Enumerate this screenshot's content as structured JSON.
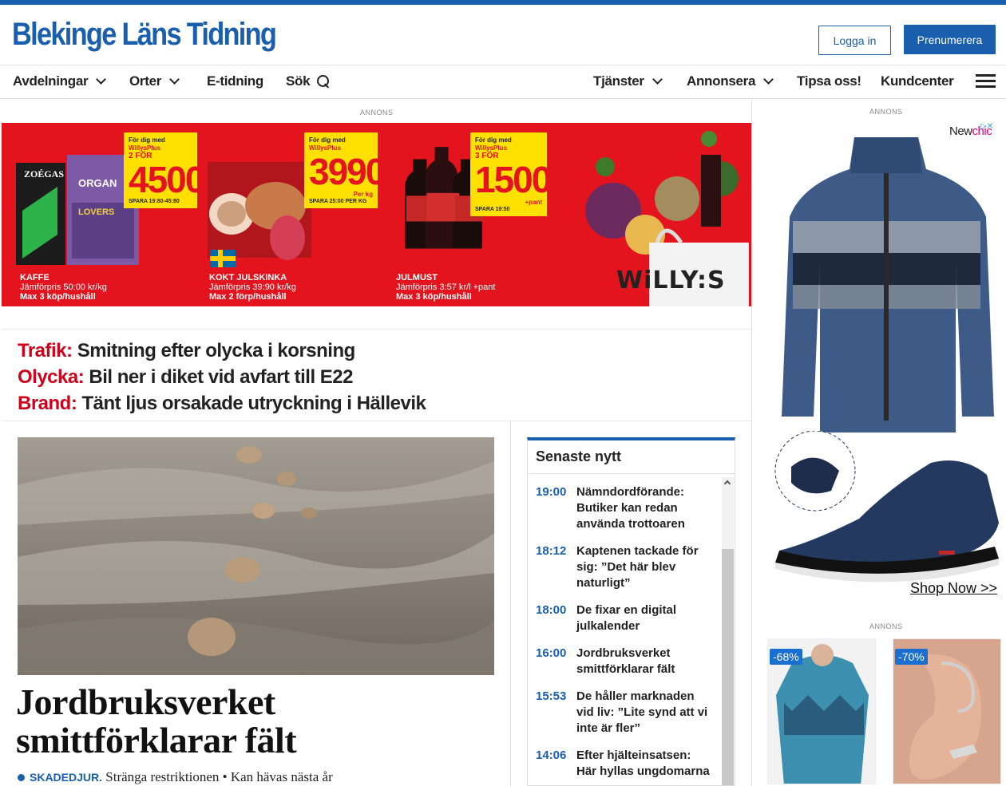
{
  "site": {
    "logo": "Blekinge Läns Tidning",
    "login_label": "Logga in",
    "subscribe_label": "Prenumerera"
  },
  "nav": {
    "left": [
      {
        "label": "Avdelningar",
        "dropdown": true
      },
      {
        "label": "Orter",
        "dropdown": true
      },
      {
        "label": "E-tidning",
        "dropdown": false
      },
      {
        "label": "Sök",
        "icon": "search-icon"
      }
    ],
    "right": [
      {
        "label": "Tjänster",
        "dropdown": true
      },
      {
        "label": "Annonsera",
        "dropdown": true
      },
      {
        "label": "Tipsa oss!",
        "dropdown": false
      },
      {
        "label": "Kundcenter",
        "dropdown": false
      }
    ],
    "menu_icon": "hamburger-icon"
  },
  "ads": {
    "label": "ANNONS",
    "willys": {
      "brand": "WiLLY:S",
      "offers": [
        {
          "tag": "För dig med",
          "program": "WillysPlus",
          "qty": "2 FÖR",
          "price": "4500",
          "save": "SPARA 19:80-45:80",
          "name": "KAFFE",
          "compare": "Jämförpris 50:00 kr/kg",
          "limit": "Max 3 köp/hushåll",
          "product_text": "ZOÉGAS"
        },
        {
          "tag": "För dig med",
          "program": "WillysPlus",
          "qty": "",
          "price": "3990",
          "unit": "Per kg",
          "save": "SPARA 25:00 PER KG",
          "name": "KOKT JULSKINKA",
          "compare": "Jämförpris 39:90 kr/kg",
          "limit": "Max 2 förp/hushåll"
        },
        {
          "tag": "För dig med",
          "program": "WillysPlus",
          "qty": "3 FÖR",
          "price": "1500",
          "unit": "+pant",
          "save": "SPARA 19:50",
          "name": "JULMUST",
          "compare": "Jämförpris 3:57 kr/l +pant",
          "limit": "Max 3 köp/hushåll"
        }
      ]
    },
    "newchic": {
      "brand_a": "New",
      "brand_b": "chic",
      "cta": "Shop Now >>"
    },
    "products": [
      {
        "discount": "-68%"
      },
      {
        "discount": "-70%"
      }
    ]
  },
  "headlines": [
    {
      "kicker": "Trafik:",
      "text": " Smitning efter olycka i korsning"
    },
    {
      "kicker": "Olycka:",
      "text": " Bil ner i diket vid avfart till E22"
    },
    {
      "kicker": "Brand:",
      "text": " Tänt ljus orsakade utryckning i Hällevik"
    }
  ],
  "article": {
    "title_line1": "Jordbruksverket",
    "title_line2": "smittförklarar fält",
    "tag": "SKADEDJUR.",
    "lead": " Stränga restriktionen • Kan hävas nästa år"
  },
  "latest": {
    "title": "Senaste nytt",
    "items": [
      {
        "time": "19:00",
        "text": "Nämndordförande: Butiker kan redan använda trottoaren"
      },
      {
        "time": "18:12",
        "text": "Kaptenen tackade för sig: ”Det här blev naturligt”"
      },
      {
        "time": "18:00",
        "text": "De fixar en digital julkalender"
      },
      {
        "time": "16:00",
        "text": "Jordbruksverket smittförklarar fält"
      },
      {
        "time": "15:53",
        "text": "De håller marknaden vid liv: ”Lite synd att vi inte är fler”"
      },
      {
        "time": "14:06",
        "text": "Efter hjälteinsatsen: Här hyllas ungdomarna"
      }
    ]
  },
  "colors": {
    "brand_blue": "#1a5fad",
    "kicker_red": "#d0021b",
    "willys_red": "#e3141e",
    "willys_yellow": "#ffe000"
  }
}
